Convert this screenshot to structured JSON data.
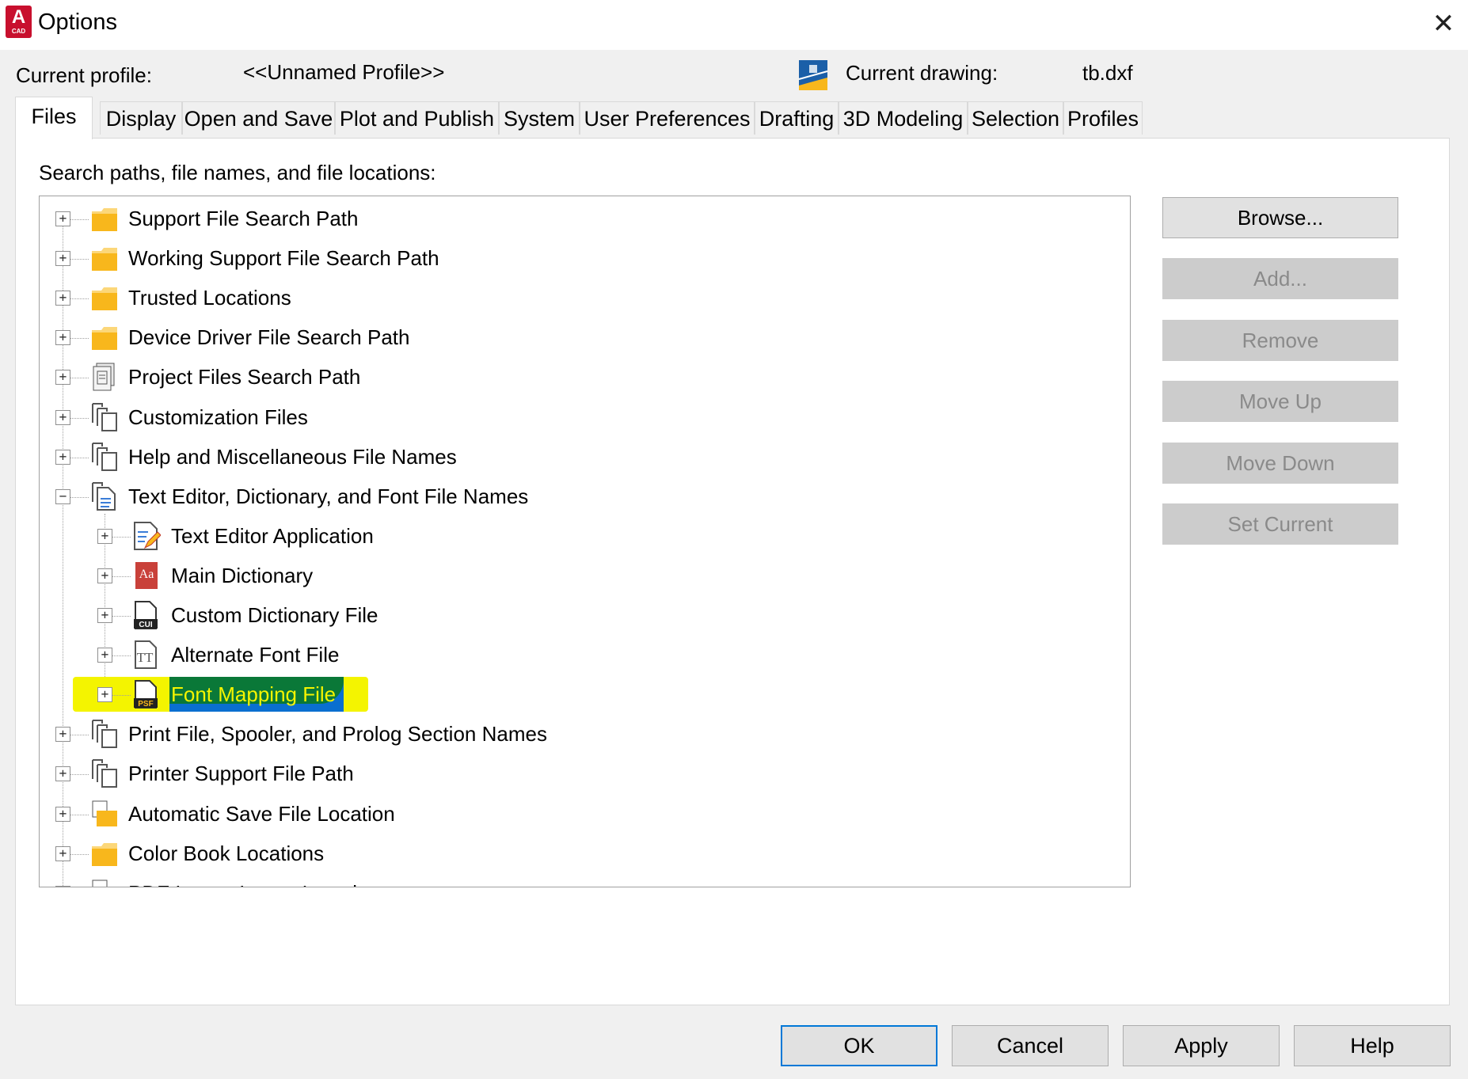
{
  "window": {
    "title": "Options",
    "logo_letter": "A",
    "logo_sub": "CAD",
    "close_glyph": "✕"
  },
  "profile": {
    "label": "Current profile:",
    "value": "<<Unnamed Profile>>",
    "drawing_label": "Current drawing:",
    "drawing_value": "tb.dxf"
  },
  "tabs": [
    "Files",
    "Display",
    "Open and Save",
    "Plot and Publish",
    "System",
    "User Preferences",
    "Drafting",
    "3D Modeling",
    "Selection",
    "Profiles"
  ],
  "active_tab": "Files",
  "panel": {
    "caption": "Search paths, file names, and file locations:"
  },
  "tree": {
    "items": [
      {
        "label": "Support File Search Path",
        "icon": "folder-icon",
        "level": 0,
        "expander": "+"
      },
      {
        "label": "Working Support File Search Path",
        "icon": "folder-icon",
        "level": 0,
        "expander": "+"
      },
      {
        "label": "Trusted Locations",
        "icon": "folder-icon",
        "level": 0,
        "expander": "+"
      },
      {
        "label": "Device Driver File Search Path",
        "icon": "folder-icon",
        "level": 0,
        "expander": "+"
      },
      {
        "label": "Project Files Search Path",
        "icon": "project-files-icon",
        "level": 0,
        "expander": "+"
      },
      {
        "label": "Customization Files",
        "icon": "file-stack-icon",
        "level": 0,
        "expander": "+"
      },
      {
        "label": "Help and Miscellaneous File Names",
        "icon": "file-stack-icon",
        "level": 0,
        "expander": "+"
      },
      {
        "label": "Text Editor, Dictionary, and Font File Names",
        "icon": "text-file-icon",
        "level": 0,
        "expander": "−"
      },
      {
        "label": "Text Editor Application",
        "icon": "text-editor-icon",
        "level": 1,
        "expander": "+"
      },
      {
        "label": "Main Dictionary",
        "icon": "dictionary-icon",
        "level": 1,
        "expander": "+"
      },
      {
        "label": "Custom Dictionary File",
        "icon": "cui-file-icon",
        "level": 1,
        "expander": "+"
      },
      {
        "label": "Alternate Font File",
        "icon": "font-file-icon",
        "level": 1,
        "expander": "+"
      },
      {
        "label": "Font Mapping File",
        "icon": "psf-file-icon",
        "level": 1,
        "expander": "+",
        "selected": true
      },
      {
        "label": "Print File, Spooler, and Prolog Section Names",
        "icon": "file-stack-icon",
        "level": 0,
        "expander": "+"
      },
      {
        "label": "Printer Support File Path",
        "icon": "file-stack-icon",
        "level": 0,
        "expander": "+"
      },
      {
        "label": "Automatic Save File Location",
        "icon": "folder-file-icon",
        "level": 0,
        "expander": "+"
      },
      {
        "label": "Color Book Locations",
        "icon": "folder-icon",
        "level": 0,
        "expander": "+"
      },
      {
        "label": "PDF Import Image Location",
        "icon": "folder-file-icon",
        "level": 0,
        "expander": "+"
      }
    ],
    "icon_texts": {
      "dictionary": "Aa",
      "cui": "CUI",
      "font": "TT",
      "psf": "PSF"
    }
  },
  "side_buttons": [
    {
      "label": "Browse...",
      "enabled": true
    },
    {
      "label": "Add...",
      "enabled": false
    },
    {
      "label": "Remove",
      "enabled": false
    },
    {
      "label": "Move Up",
      "enabled": false
    },
    {
      "label": "Move Down",
      "enabled": false
    },
    {
      "label": "Set Current",
      "enabled": false
    }
  ],
  "footer_buttons": [
    {
      "label": "OK",
      "default": true
    },
    {
      "label": "Cancel"
    },
    {
      "label": "Apply"
    },
    {
      "label": "Help"
    }
  ],
  "scrollbar": {
    "up_glyph": "︿",
    "down_glyph": "﹀"
  },
  "colors": {
    "accent": "#0078d7",
    "selection": "#0a6fd0",
    "highlight_marker": "#f4f400",
    "folder": "#f8b71c",
    "logo": "#c8102e"
  }
}
